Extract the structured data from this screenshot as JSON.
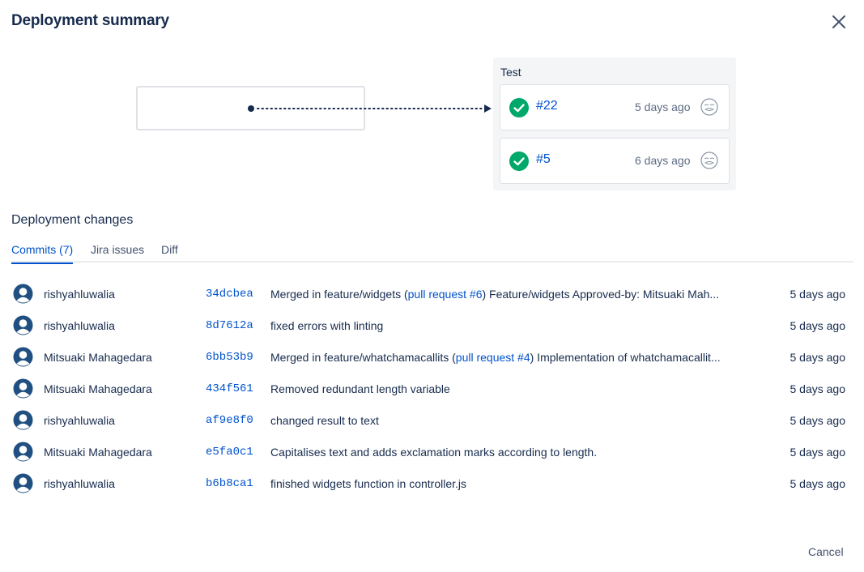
{
  "dialog": {
    "title": "Deployment summary",
    "close_icon": "close-icon"
  },
  "environment": {
    "name": "Test",
    "deployments": [
      {
        "number": "#22",
        "time": "5 days ago",
        "status": "success"
      },
      {
        "number": "#5",
        "time": "6 days ago",
        "status": "success"
      }
    ]
  },
  "changes": {
    "title": "Deployment changes",
    "tabs": [
      {
        "label": "Commits (7)",
        "active": true
      },
      {
        "label": "Jira issues",
        "active": false
      },
      {
        "label": "Diff",
        "active": false
      }
    ],
    "commits": [
      {
        "author": "rishyahluwalia",
        "hash": "34dcbea",
        "msg_pre": "Merged in feature/widgets (",
        "msg_link": "pull request #6",
        "msg_post": ") Feature/widgets Approved-by: Mitsuaki Mah...",
        "time": "5 days ago"
      },
      {
        "author": "rishyahluwalia",
        "hash": "8d7612a",
        "msg_pre": "fixed errors with linting",
        "msg_link": "",
        "msg_post": "",
        "time": "5 days ago"
      },
      {
        "author": "Mitsuaki Mahagedara",
        "hash": "6bb53b9",
        "msg_pre": "Merged in feature/whatchamacallits (",
        "msg_link": "pull request #4",
        "msg_post": ") Implementation of whatchamacallit...",
        "time": "5 days ago"
      },
      {
        "author": "Mitsuaki Mahagedara",
        "hash": "434f561",
        "msg_pre": "Removed redundant length variable",
        "msg_link": "",
        "msg_post": "",
        "time": "5 days ago"
      },
      {
        "author": "rishyahluwalia",
        "hash": "af9e8f0",
        "msg_pre": "changed result to text",
        "msg_link": "",
        "msg_post": "",
        "time": "5 days ago"
      },
      {
        "author": "Mitsuaki Mahagedara",
        "hash": "e5fa0c1",
        "msg_pre": "Capitalises text and adds exclamation marks according to length.",
        "msg_link": "",
        "msg_post": "",
        "time": "5 days ago"
      },
      {
        "author": "rishyahluwalia",
        "hash": "b6b8ca1",
        "msg_pre": "finished widgets function in controller.js",
        "msg_link": "",
        "msg_post": "",
        "time": "5 days ago"
      }
    ]
  },
  "footer": {
    "cancel_label": "Cancel"
  },
  "colors": {
    "link": "#0052cc",
    "success": "#00a86b",
    "text": "#172b4d",
    "muted": "#5e6c84",
    "avatar": "#205081"
  }
}
